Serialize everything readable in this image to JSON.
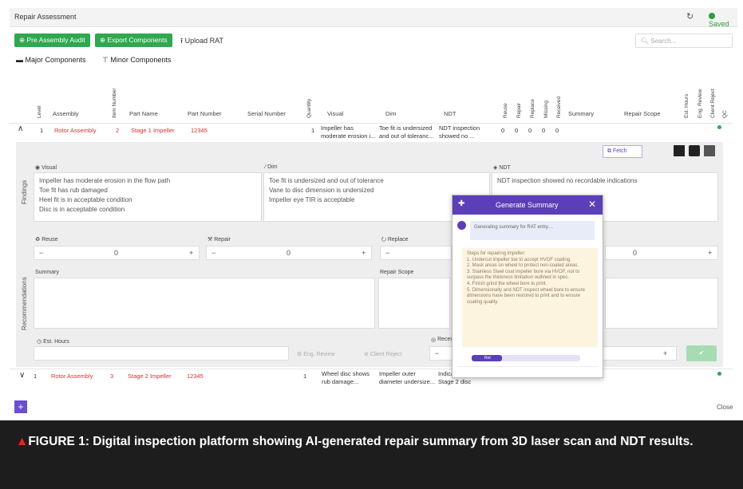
{
  "header": {
    "title": "Repair Assessment",
    "saved": "Saved"
  },
  "toolbar": {
    "pre_assembly": "Pre Assembly Audit",
    "export": "Export Components",
    "upload": "Upload RAT",
    "search_placeholder": "Search..."
  },
  "tabs": {
    "major": "Major Components",
    "minor": "Minor Components"
  },
  "columns": {
    "level": "Level",
    "assembly": "Assembly",
    "item_number": "Item Number",
    "part_name": "Part Name",
    "part_number": "Part Number",
    "serial_number": "Serial Number",
    "quantity": "Quantity",
    "visual": "Visual",
    "dim": "Dim",
    "ndt": "NDT",
    "reuse": "Reuse",
    "repair": "Repair",
    "replace": "Replace",
    "missing": "Missing",
    "received": "Received",
    "summary": "Summary",
    "repair_scope": "Repair Scope",
    "est_hours": "Est. Hours",
    "eng_review": "Eng. Review",
    "client_reject": "Client Reject",
    "qc": "QC"
  },
  "rows": [
    {
      "level": "1",
      "assembly": "Rotor Assembly",
      "item": "2",
      "part_name": "Stage 1 Impeller",
      "part_number": "12345",
      "qty": "1",
      "visual": "Impeller has moderate erosion i...",
      "dim": "Toe fit is undersized and out of toleranc...",
      "ndt": "NDT inspection showed no ...",
      "counts": [
        "0",
        "0",
        "0",
        "0",
        "0"
      ]
    },
    {
      "level": "1",
      "assembly": "Rotor Assembly",
      "item": "3",
      "part_name": "Stage 2 Impeller",
      "part_number": "12345",
      "qty": "1",
      "visual": "Wheel disc shows rub damage...",
      "dim": "Impeller outer diameter undersize...",
      "ndt": "Indications on Stage 2 disc"
    }
  ],
  "findings": {
    "label": "Findings",
    "visual_label": "Visual",
    "visual_lines": [
      "Impeller has moderate erosion in the flow path",
      "Toe fit has rub damaged",
      "Heel fit is in acceptable condition",
      "Disc is in acceptable condition"
    ],
    "dim_label": "Dim",
    "dim_lines": [
      "Toe fit is undersized and out of tolerance",
      "Vane to disc dimension is undersized",
      "Impeller eye TIR is acceptable"
    ],
    "ndt_label": "NDT",
    "ndt_lines": [
      "NDT inspection showed no recordable indications"
    ],
    "fetch": "Fetch"
  },
  "recommendations": {
    "label": "Recommendations",
    "reuse": "Reuse",
    "repair": "Repair",
    "replace": "Replace",
    "reuse_value": "0",
    "repair_value": "0",
    "replace_value": "0",
    "received_value": "0",
    "summary": "Summary",
    "repair_scope": "Repair Scope",
    "est_hours": "Est. Hours",
    "eng_review": "Eng. Review",
    "client_reject": "Client Reject",
    "received": "Received"
  },
  "modal": {
    "title": "Generate Summary",
    "status": "Generating summary for RAT entry....",
    "steps": "Steps for repairing impeller:\n1. Undercut impeller toe to accept HVOF coating.\n2. Mask areas on wheel to protect non-coated areas.\n3. Stainless Steel coat impeller bore via HVOF, not to surpass the thickness limitation outlined in spec.\n4. Finish grind the wheel bore to print.\n5. Dimensionally and NDT inspect wheel bore to ensure dimensions have been restored to print and to ensure coating quality.",
    "progress": 0.28,
    "progress_label": "Ret"
  },
  "footer": {
    "close": "Close"
  },
  "caption": "FIGURE 1: Digital inspection platform showing AI-generated repair summary from 3D laser scan and NDT results.",
  "colors": {
    "accent_green": "#2fa84f",
    "purple": "#5b3fb8",
    "red_text": "#d9322d"
  }
}
